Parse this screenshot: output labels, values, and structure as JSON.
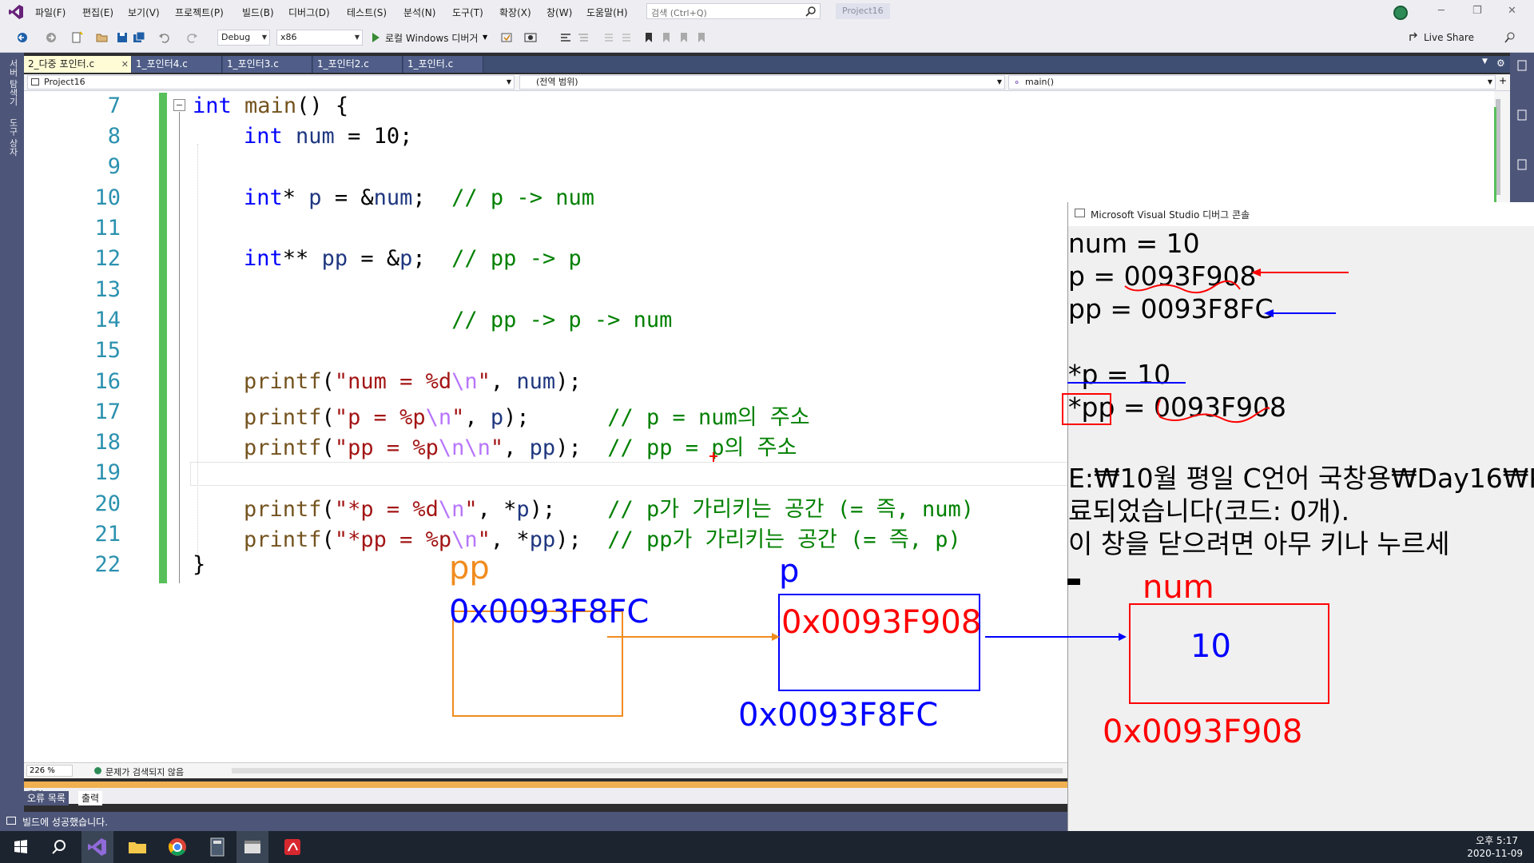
{
  "menubar": {
    "items": [
      "파일(F)",
      "편집(E)",
      "보기(V)",
      "프로젝트(P)",
      "빌드(B)",
      "디버그(D)",
      "테스트(S)",
      "분석(N)",
      "도구(T)",
      "확장(X)",
      "창(W)",
      "도움말(H)"
    ],
    "search_placeholder": "검색 (Ctrl+Q)",
    "solution_name": "Project16"
  },
  "toolbar": {
    "config": "Debug",
    "platform": "x86",
    "run_label": "로컬 Windows 디버거",
    "live_share": "Live Share"
  },
  "left_strip": {
    "tabs": [
      "서버 탐색기",
      "도구 상자"
    ]
  },
  "tabs": [
    {
      "label": "2_다중 포인터.c",
      "active": true
    },
    {
      "label": "1_포인터4.c",
      "active": false
    },
    {
      "label": "1_포인터3.c",
      "active": false
    },
    {
      "label": "1_포인터2.c",
      "active": false
    },
    {
      "label": "1_포인터.c",
      "active": false
    }
  ],
  "navbar": {
    "project": "Project16",
    "scope": "(전역 범위)",
    "function": "main()"
  },
  "editor": {
    "line_numbers": [
      "7",
      "8",
      "9",
      "10",
      "11",
      "12",
      "13",
      "14",
      "15",
      "16",
      "17",
      "18",
      "19",
      "20",
      "21",
      "22"
    ]
  },
  "console": {
    "title": "Microsoft Visual Studio 디버그 콘솔",
    "lines": [
      "num = 10",
      "p = 0093F908",
      "pp = 0093F8FC",
      "",
      "*p = 10",
      "*pp = 0093F908",
      "",
      "E:₩10월 평일 C언어 국창용₩Day16₩P",
      "료되었습니다(코드: 0개).",
      "이 창을 닫으려면 아무 키나 누르세"
    ]
  },
  "diagram": {
    "pp_label": "pp",
    "pp_value": "0x0093F8FC",
    "p_label": "p",
    "p_value": "0x0093F908",
    "p_address": "0x0093F8FC",
    "num_label": "num",
    "num_value": "10",
    "num_address": "0x0093F908"
  },
  "status": {
    "zoom": "226 %",
    "issues": "문제가 검색되지 않음",
    "bottom_tabs": [
      "오류 목록",
      "출력"
    ],
    "bottom_tabs_label": "출력",
    "build_message": "빌드에 성공했습니다."
  },
  "taskbar": {
    "time": "오후 5:17",
    "date": "2020-11-09"
  },
  "colors": {
    "vs_blue": "#4d5679",
    "code_keyword": "#0000ff",
    "code_comment": "#008000",
    "code_string": "#a31515",
    "annot_orange": "#f08c1e",
    "annot_blue": "#0000ff",
    "annot_red": "#ff0000"
  }
}
